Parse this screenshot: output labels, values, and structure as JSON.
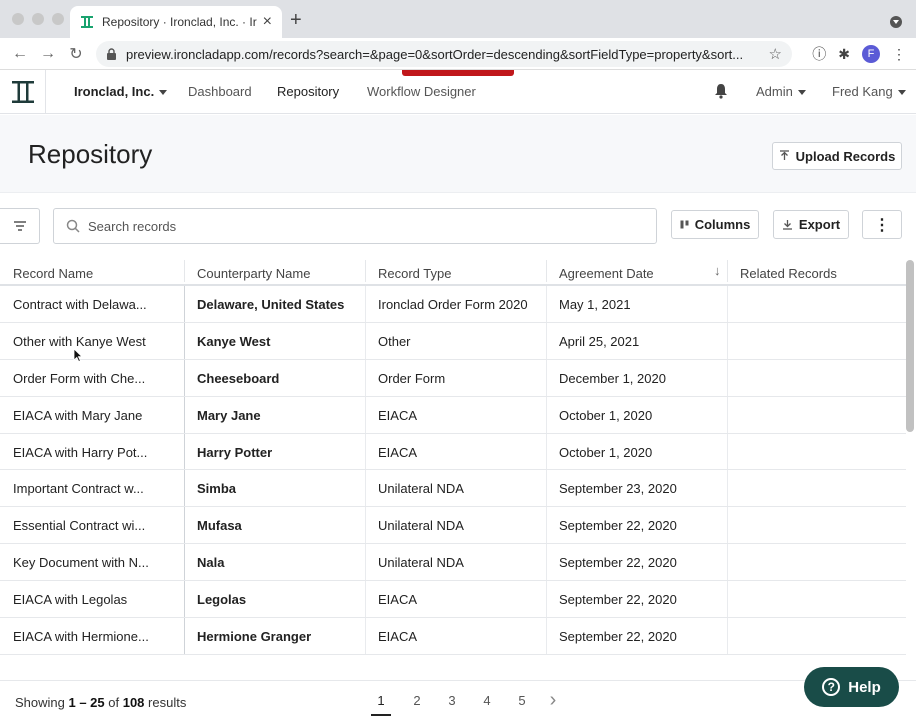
{
  "browser": {
    "tab_title": "Repository · Ironclad, Inc. · Iro",
    "new_tab": "+",
    "url": "preview.ironcladapp.com/records?search=&page=0&sortOrder=descending&sortFieldType=property&sort...",
    "profile_initial": "F"
  },
  "header": {
    "company": "Ironclad, Inc.",
    "nav": [
      "Dashboard",
      "Repository",
      "Workflow Designer"
    ],
    "admin": "Admin",
    "user": "Fred Kang"
  },
  "page": {
    "title": "Repository",
    "upload_label": "Upload Records"
  },
  "toolbar": {
    "search_placeholder": "Search records",
    "columns_label": "Columns",
    "export_label": "Export"
  },
  "table": {
    "headers": [
      "Record Name",
      "Counterparty Name",
      "Record Type",
      "Agreement Date",
      "Related Records"
    ],
    "rows": [
      [
        "Contract with Delawa...",
        "Delaware, United States",
        "Ironclad Order Form 2020",
        "May 1, 2021",
        ""
      ],
      [
        "Other with Kanye West",
        "Kanye West",
        "Other",
        "April 25, 2021",
        ""
      ],
      [
        "Order Form with Che...",
        "Cheeseboard",
        "Order Form",
        "December 1, 2020",
        ""
      ],
      [
        "EIACA with Mary Jane",
        "Mary Jane",
        "EIACA",
        "October 1, 2020",
        ""
      ],
      [
        "EIACA with Harry Pot...",
        "Harry Potter",
        "EIACA",
        "October 1, 2020",
        ""
      ],
      [
        "Important Contract w...",
        "Simba",
        "Unilateral NDA",
        "September 23, 2020",
        ""
      ],
      [
        "Essential Contract wi...",
        "Mufasa",
        "Unilateral NDA",
        "September 22, 2020",
        ""
      ],
      [
        "Key Document with N...",
        "Nala",
        "Unilateral NDA",
        "September 22, 2020",
        ""
      ],
      [
        "EIACA with Legolas",
        "Legolas",
        "EIACA",
        "September 22, 2020",
        ""
      ],
      [
        "EIACA with Hermione...",
        "Hermione Granger",
        "EIACA",
        "September 22, 2020",
        ""
      ]
    ]
  },
  "footer": {
    "showing_prefix": "Showing ",
    "range": "1 – 25",
    "of": " of ",
    "total": "108",
    "suffix": " results",
    "pages": [
      "1",
      "2",
      "3",
      "4",
      "5"
    ],
    "next": "›"
  },
  "help": {
    "label": "Help",
    "glyph": "?"
  },
  "colors": {
    "accent_red": "#c0171b",
    "help_bg": "#194c48",
    "logo": "#1f3b3a",
    "favicon": "#1aa36f"
  }
}
